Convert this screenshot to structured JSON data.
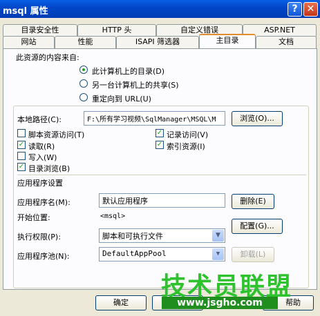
{
  "window": {
    "title": "msql 属性",
    "help_glyph": "?",
    "close_glyph": "✕"
  },
  "tabs_row1": [
    "目录安全性",
    "HTTP 头",
    "自定义错误",
    "ASP.NET"
  ],
  "tabs_row2": [
    "网站",
    "性能",
    "ISAPI 筛选器",
    "主目录",
    "文档"
  ],
  "active_tab": "主目录",
  "source": {
    "heading": "此资源的内容来自:",
    "options": [
      "此计算机上的目录(D)",
      "另一台计算机上的共享(S)",
      "重定向到 URL(U)"
    ],
    "selected": 0
  },
  "local_path": {
    "label": "本地路径(C):",
    "value": "F:\\所有学习视频\\SqlManager\\MSQL\\M",
    "browse_button": "浏览(O)..."
  },
  "checkboxes": [
    {
      "label": "脚本资源访问(T)",
      "checked": false
    },
    {
      "label": "读取(R)",
      "checked": true
    },
    {
      "label": "写入(W)",
      "checked": false
    },
    {
      "label": "目录浏览(B)",
      "checked": true
    },
    {
      "label": "记录访问(V)",
      "checked": true
    },
    {
      "label": "索引资源(I)",
      "checked": true
    }
  ],
  "app_settings": {
    "heading": "应用程序设置",
    "app_name_label": "应用程序名(M):",
    "app_name_value": "默认应用程序",
    "remove_button": "删除(E)",
    "start_label": "开始位置:",
    "start_value": "<msql>",
    "config_button": "配置(G)...",
    "exec_label": "执行权限(P):",
    "exec_value": "脚本和可执行文件",
    "pool_label": "应用程序池(N):",
    "pool_value": "DefaultAppPool",
    "unload_button": "卸载(L)"
  },
  "footer": {
    "ok_button": "确定",
    "help_button": "帮助"
  },
  "watermark": {
    "text": "技术员联盟",
    "url": "www.jsgho.com"
  }
}
